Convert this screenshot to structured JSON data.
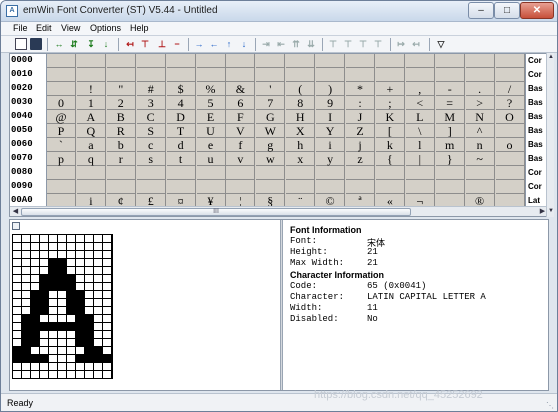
{
  "window": {
    "title": "emWin Font Converter (ST) V5.44 - Untitled",
    "app_icon": "app-icon"
  },
  "menu": [
    "File",
    "Edit",
    "View",
    "Options",
    "Help"
  ],
  "toolbar_icons": [
    "new-icon",
    "save-icon",
    "expand-width-icon",
    "expand-both-icon",
    "move-down-icon",
    "move-down-line-icon",
    "shrink-width-icon",
    "shrink-top-icon",
    "shrink-bottom-icon",
    "shift-right-icon",
    "shift-left-icon",
    "shift-up-icon",
    "shift-down-icon",
    "first-icon",
    "prev-icon",
    "collapse-icon",
    "align-top-icon",
    "align-top2-icon",
    "align-mid-icon",
    "align-bottom-icon",
    "move-right-icon",
    "move-left-icon",
    "filter-icon"
  ],
  "codes": [
    "0000",
    "0010",
    "0020",
    "0030",
    "0040",
    "0050",
    "0060",
    "0070",
    "0080",
    "0090",
    "00A0"
  ],
  "grid_rows": [
    [
      "",
      "",
      "",
      "",
      "",
      "",
      "",
      "",
      "",
      "",
      "",
      "",
      "",
      "",
      "",
      ""
    ],
    [
      "",
      "",
      "",
      "",
      "",
      "",
      "",
      "",
      "",
      "",
      "",
      "",
      "",
      "",
      "",
      ""
    ],
    [
      "",
      "!",
      "\"",
      "#",
      "$",
      "%",
      "&",
      "'",
      "(",
      ")",
      "*",
      "+",
      ",",
      "-",
      ".",
      "/"
    ],
    [
      "0",
      "1",
      "2",
      "3",
      "4",
      "5",
      "6",
      "7",
      "8",
      "9",
      ":",
      ";",
      "<",
      "=",
      ">",
      "?"
    ],
    [
      "@",
      "A",
      "B",
      "C",
      "D",
      "E",
      "F",
      "G",
      "H",
      "I",
      "J",
      "K",
      "L",
      "M",
      "N",
      "O"
    ],
    [
      "P",
      "Q",
      "R",
      "S",
      "T",
      "U",
      "V",
      "W",
      "X",
      "Y",
      "Z",
      "[",
      "\\",
      "]",
      "^",
      ""
    ],
    [
      "`",
      "a",
      "b",
      "c",
      "d",
      "e",
      "f",
      "g",
      "h",
      "i",
      "j",
      "k",
      "l",
      "m",
      "n",
      "o"
    ],
    [
      "p",
      "q",
      "r",
      "s",
      "t",
      "u",
      "v",
      "w",
      "x",
      "y",
      "z",
      "{",
      "|",
      "}",
      "~",
      ""
    ],
    [
      "",
      "",
      "",
      "",
      "",
      "",
      "",
      "",
      "",
      "",
      "",
      "",
      "",
      "",
      "",
      ""
    ],
    [
      "",
      "",
      "",
      "",
      "",
      "",
      "",
      "",
      "",
      "",
      "",
      "",
      "",
      "",
      "",
      ""
    ],
    [
      "",
      "i",
      "¢",
      "£",
      "¤",
      "¥",
      "¦",
      "§",
      "¨",
      "©",
      "ª",
      "«",
      "¬",
      "",
      "®",
      ""
    ]
  ],
  "side_labels": [
    "Cor",
    "Cor",
    "Bas",
    "Bas",
    "Bas",
    "Bas",
    "Bas",
    "Bas",
    "Cor",
    "Cor",
    "Lat"
  ],
  "scroll_thumb_label": "III",
  "font_info": {
    "header": "Font Information",
    "font_label": "Font:",
    "font_value": "宋体",
    "height_label": "Height:",
    "height_value": "21",
    "maxwidth_label": "Max Width:",
    "maxwidth_value": "21"
  },
  "char_info": {
    "header": "Character Information",
    "code_label": "Code:",
    "code_value": "65 (0x0041)",
    "char_label": "Character:",
    "char_value": "LATIN CAPITAL LETTER A",
    "width_label": "Width:",
    "width_value": "11",
    "disabled_label": "Disabled:",
    "disabled_value": "No"
  },
  "glyph": {
    "cols": 11,
    "rows": 18,
    "bitmap": [
      "00000000000",
      "00000000000",
      "00000000000",
      "00001100000",
      "00001100000",
      "00011110000",
      "00011110000",
      "00110011000",
      "00110011000",
      "00110011000",
      "01100001100",
      "01111111100",
      "01100001100",
      "01100001100",
      "11000000110",
      "11110001111",
      "00000000000",
      "00000000000"
    ]
  },
  "status": "Ready",
  "watermark": "https://blog.csdn.net/qq_45252692"
}
